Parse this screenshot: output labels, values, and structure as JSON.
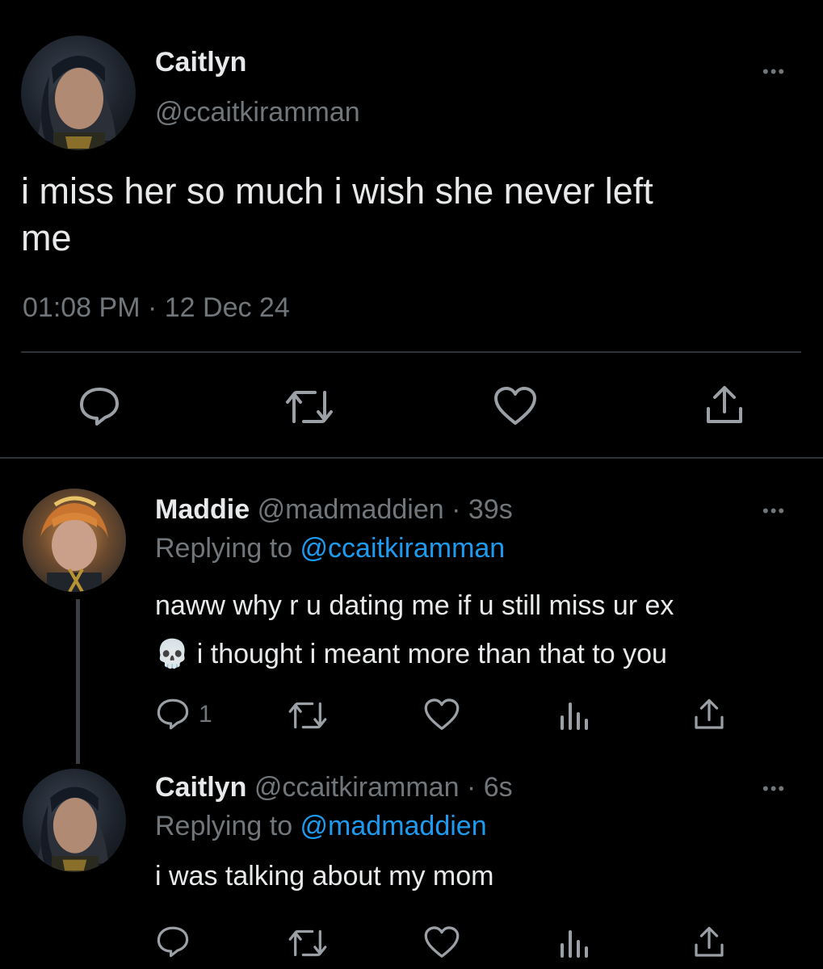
{
  "main_tweet": {
    "name": "Caitlyn",
    "handle": "@ccaitkiramman",
    "text_line1": "i miss her so much i wish she never left",
    "text_line2": "me",
    "timestamp": "01:08 PM · 12 Dec 24",
    "more": "•••"
  },
  "reply1": {
    "name": "Maddie",
    "handle_time": "@madmaddien · 39s",
    "replying_prefix": "Replying to ",
    "replying_to": "@ccaitkiramman",
    "text_line1": "naww why r u dating me if u still miss ur ex",
    "text_line2": "💀 i thought i meant more than that to you",
    "reply_count": "1",
    "more": "•••"
  },
  "reply2": {
    "name": "Caitlyn",
    "handle_time": "@ccaitkiramman · 6s",
    "replying_prefix": "Replying to ",
    "replying_to": "@madmaddien",
    "text": "i was talking about my mom",
    "more": "•••"
  },
  "icons": {
    "reply": "comment-icon",
    "retweet": "retweet-icon",
    "like": "heart-icon",
    "views": "views-icon",
    "share": "share-icon"
  },
  "colors": {
    "background": "#000000",
    "text": "#e7e9ea",
    "muted": "#71767b",
    "link": "#1d9bf0",
    "divider": "#2f3336"
  }
}
